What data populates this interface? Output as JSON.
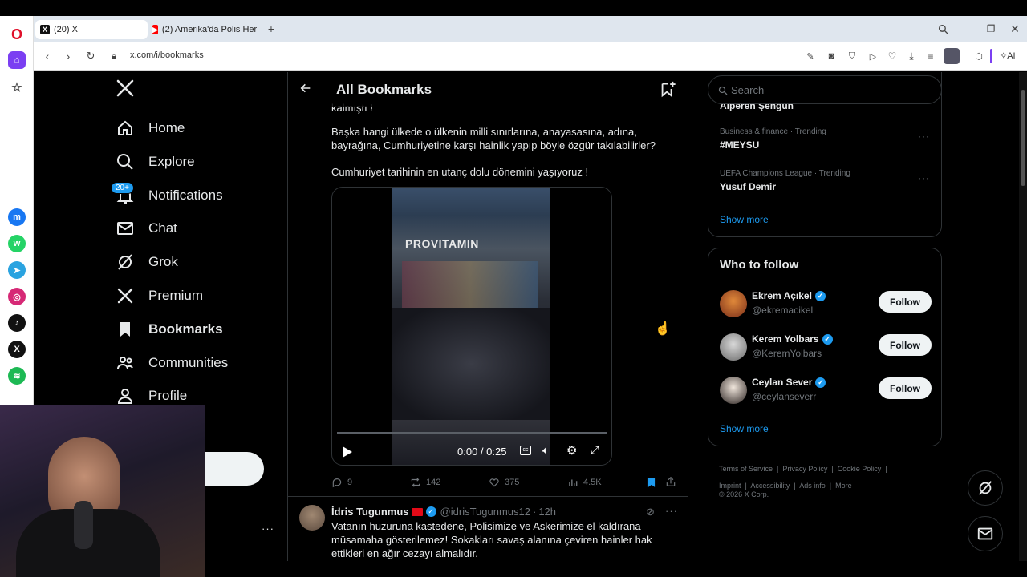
{
  "browser": {
    "tabs": [
      {
        "label": "(20) X",
        "active": true
      },
      {
        "label": "(2) Amerika'da Polis Her Ş...",
        "active": false
      }
    ],
    "url": "x.com/i/bookmarks",
    "ai_label": "AI"
  },
  "sidebar": {
    "notifications_badge": "20+",
    "items": [
      {
        "label": "Home",
        "icon": "home-icon"
      },
      {
        "label": "Explore",
        "icon": "search-icon"
      },
      {
        "label": "Notifications",
        "icon": "bell-icon"
      },
      {
        "label": "Chat",
        "icon": "mail-icon"
      },
      {
        "label": "Grok",
        "icon": "grok-icon"
      },
      {
        "label": "Premium",
        "icon": "x-logo-icon"
      },
      {
        "label": "Bookmarks",
        "icon": "bookmark-icon"
      },
      {
        "label": "Communities",
        "icon": "people-icon"
      },
      {
        "label": "Profile",
        "icon": "person-icon"
      }
    ],
    "account_name_partial": "i",
    "account_handle_partial": "ri"
  },
  "header": {
    "title": "All Bookmarks"
  },
  "tweet1": {
    "cutoff_text": "kalmıştı !",
    "paragraph1": "Başka hangi ülkede o ülkenin milli sınırlarına, anayasasına, adına, bayrağına, Cumhuriyetine karşı hainlik yapıp böyle özgür takılabilirler?",
    "paragraph2": "Cumhuriyet tarihinin en utanç dolu dönemini yaşıyoruz !",
    "video": {
      "store_sign": "PROVITAMIN",
      "time": "0:00 / 0:25",
      "progress": 0
    },
    "replies": "9",
    "reposts": "142",
    "likes": "375",
    "views": "4.5K"
  },
  "tweet2": {
    "name": "İdris Tugunmus",
    "handle": "@idrisTugunmus12",
    "time": "12h",
    "text": "Vatanın huzuruna kastedene, Polisimize ve Askerimize el kaldırana müsamaha gösterilemez! Sokakları savaş alanına çeviren hainler hak ettikleri en ağır cezayı almalıdır."
  },
  "search": {
    "placeholder": "Search"
  },
  "trends": {
    "cutoff_name": "Alperen Şengün",
    "items": [
      {
        "meta": "Business & finance · Trending",
        "name": "#MEYSU"
      },
      {
        "meta": "UEFA Champions League · Trending",
        "name": "Yusuf Demir"
      }
    ],
    "show_more": "Show more"
  },
  "who_to_follow": {
    "title": "Who to follow",
    "users": [
      {
        "name": "Ekrem Açıkel",
        "handle": "@ekremacikel",
        "button": "Follow"
      },
      {
        "name": "Kerem Yolbars",
        "handle": "@KeremYolbars",
        "button": "Follow"
      },
      {
        "name": "Ceylan Sever",
        "handle": "@ceylanseverr",
        "button": "Follow"
      }
    ],
    "show_more": "Show more"
  },
  "footer": {
    "links": [
      "Terms of Service",
      "Privacy Policy",
      "Cookie Policy",
      "Imprint",
      "Accessibility",
      "Ads info",
      "More ···"
    ],
    "copyright": "© 2026 X Corp."
  },
  "colors": {
    "accent": "#1d9bf0",
    "background": "#000000",
    "border": "#2f3336",
    "muted": "#71767b"
  }
}
